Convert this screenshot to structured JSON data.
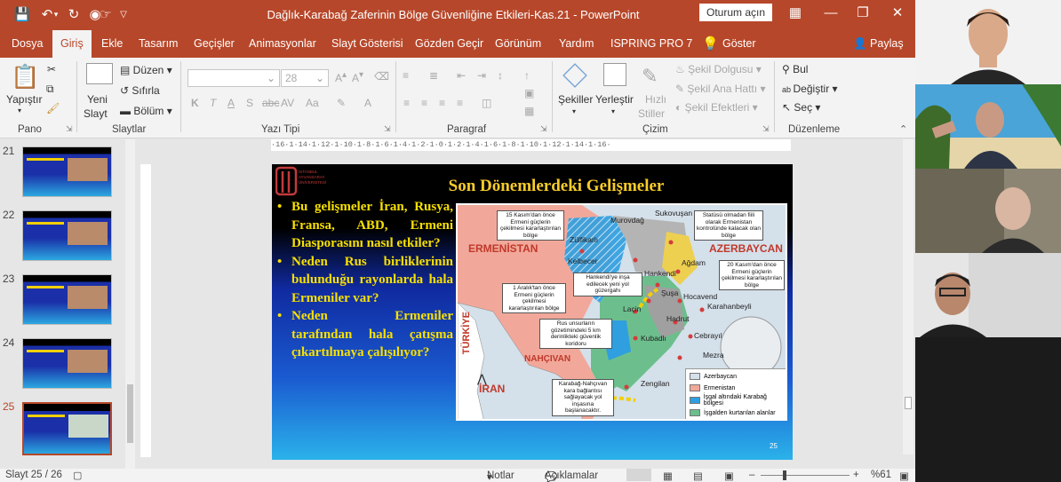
{
  "app": {
    "title": "Dağlık-Karabağ Zaferinin Bölge Güvenliğine Etkileri-Kas.21  -  PowerPoint",
    "signin": "Oturum açın"
  },
  "tabs": [
    "Dosya",
    "Giriş",
    "Ekle",
    "Tasarım",
    "Geçişler",
    "Animasyonlar",
    "Slayt Gösterisi",
    "Gözden Geçir",
    "Görünüm",
    "Yardım",
    "ISPRING PRO 7",
    "Göster"
  ],
  "share_label": "Paylaş",
  "ribbon": {
    "pano": {
      "label": "Pano",
      "paste": "Yapıştır"
    },
    "slaytlar": {
      "label": "Slaytlar",
      "new_slide_1": "Yeni",
      "new_slide_2": "Slayt",
      "layout": "Düzen",
      "reset": "Sıfırla",
      "section": "Bölüm"
    },
    "yazi_tipi": {
      "label": "Yazı Tipi",
      "font_size": "28"
    },
    "paragraf": {
      "label": "Paragraf"
    },
    "cizim": {
      "label": "Çizim",
      "shapes": "Şekiller",
      "arrange": "Yerleştir",
      "quick_1": "Hızlı",
      "quick_2": "Stiller",
      "fill": "Şekil Dolgusu",
      "outline": "Şekil Ana Hattı",
      "effects": "Şekil Efektleri"
    },
    "duzenleme": {
      "label": "Düzenleme",
      "find": "Bul",
      "replace": "Değiştir",
      "select": "Seç"
    }
  },
  "thumbnails": [
    {
      "num": "21"
    },
    {
      "num": "22"
    },
    {
      "num": "23"
    },
    {
      "num": "24"
    },
    {
      "num": "25"
    }
  ],
  "ruler_text": "·16·1·14·1·12·1·10·1·8·1·6·1·4·1·2·1·0·1·2·1·4·1·6·1·8·1·10·1·12·1·14·1·16·",
  "slide": {
    "title": "Son Dönemlerdeki Gelişmeler",
    "logo_text": "İSTANBUL AYVANSARAY ÜNİVERSİTESİ",
    "bullets": [
      "Bu gelişmeler İran, Rusya, Fransa, ABD, Ermeni Diasporasını nasıl etkiler?",
      "Neden Rus birliklerinin bulunduğu rayonlarda hala Ermeniler var?",
      "Neden Ermeniler tarafından hala çatışma çıkartılmaya çalışılıyor?"
    ],
    "number": "25",
    "map": {
      "countries": {
        "armenia": "ERMENİSTAN",
        "azerbaijan": "AZERBAYCAN",
        "turkey": "TÜRKİYE",
        "iran": "İRAN",
        "nakhchivan": "NAHÇIVAN"
      },
      "places": [
        "Murovdağ",
        "Sukovuşan",
        "Zülfikarlı",
        "Kelbecer",
        "Ağdam",
        "Hankendi",
        "Şuşa",
        "Hocavend",
        "Laçin",
        "Hadrut",
        "Karahanbeyli",
        "Kubadlı",
        "Cebrayıl",
        "Mezra",
        "Zengilan"
      ],
      "notes": [
        "15 Kasım'dan önce Ermeni güçlerin çekilmesi kararlaştırılan bölge",
        "Statüsü olmadan fiili olarak Ermenistan kontrolünde kalacak olan bölge",
        "20 Kasım'dan önce Ermeni güçlerin çekilmesi kararlaştırılan bölge",
        "Hankendi'ye inşa edilecek yeni yol güzergahı",
        "1 Aralık'tan önce Ermeni güçlerin çekilmesi kararlaştırılan bölge",
        "Rus unsurların gözetimindeki 5 km derinlikteki güvenlik koridoru",
        "Karabağ-Nahçıvan kara bağlantısı sağlayacak yol inşasına başlanacaktır."
      ],
      "legend": [
        "Azerbaycan",
        "Ermenistan",
        "İşgal altındaki Karabağ bölgesi",
        "İşgalden kurtarılan alanlar"
      ],
      "colors": {
        "azerbaijan": "#d4e0ea",
        "armenia": "#f1a89a",
        "occupied": "#2f9fe0",
        "liberated": "#6cbf8c"
      }
    }
  },
  "status": {
    "slide_count": "Slayt 25 / 26",
    "notes": "Notlar",
    "comments": "Açıklamalar",
    "zoom": "%61"
  },
  "colors": {
    "accent": "#b7472a",
    "slide_title": "#f7cc2a",
    "bullet_text": "#f7e000"
  }
}
